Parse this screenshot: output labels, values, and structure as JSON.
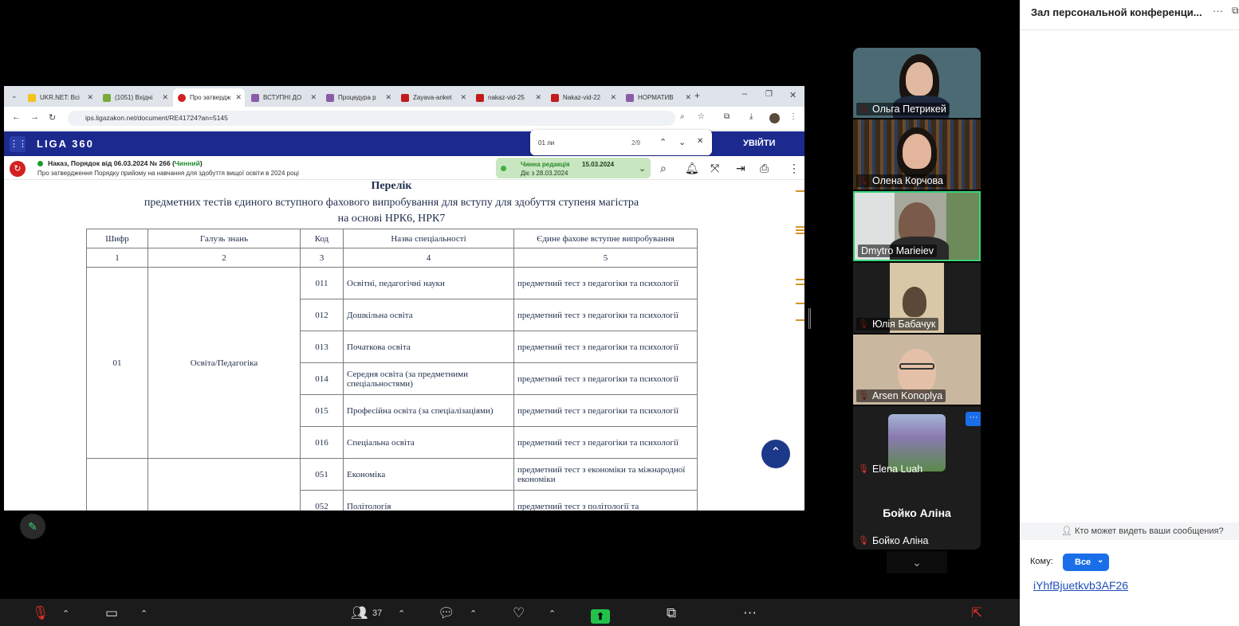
{
  "browser": {
    "tabs": [
      "UKR.NET: Всі",
      "(1051) Вхідні",
      "Про затвердж",
      "ВСТУПНІ ДО",
      "Процедура р",
      "Zayava-anket",
      "nakaz-vid-25",
      "Nakaz-vid-22",
      "НОРМАТИВ"
    ],
    "url": "ips.ligazakon.net/document/RE41724?an=5145",
    "find_query": "01 ли",
    "find_count": "2/9"
  },
  "liga": {
    "brand": "LIGA 360",
    "login": "УВІЙТИ"
  },
  "doc": {
    "title_prefix": "Наказ, Порядок від 06.03.2024 № 266 (",
    "status": "Чинний",
    "title_suffix": ")",
    "subtitle": "Про затвердження Порядку прийому на навчання для здобуття вищої освіти в 2024 році",
    "redaction_label": "Чинна редакція",
    "redaction_date": "15.03.2024",
    "valid_from": "Діє з 28.03.2024"
  },
  "content": {
    "title1": "Перелік",
    "title2": "предметних тестів єдиного вступного фахового випробування для вступу для здобуття ступеня магістра",
    "title3": "на основі НРК6, НРК7",
    "headers": [
      "Шифр",
      "Галузь знань",
      "Код",
      "Назва спеціальності",
      "Єдине фахове вступне випробування"
    ],
    "numbers": [
      "1",
      "2",
      "3",
      "4",
      "5"
    ],
    "group_code": "01",
    "group_name": "Освіта/Педагогіка",
    "rows": [
      {
        "code": "011",
        "name": "Освітні, педагогічні науки",
        "test": "предметний тест з педагогіки та психології"
      },
      {
        "code": "012",
        "name": "Дошкільна освіта",
        "test": "предметний тест з педагогіки та психології"
      },
      {
        "code": "013",
        "name": "Початкова освіта",
        "test": "предметний тест з педагогіки та психології"
      },
      {
        "code": "014",
        "name": "Середня освіта (за предметними спеціальностями)",
        "test": "предметний тест з педагогіки та психології"
      },
      {
        "code": "015",
        "name": "Професійна освіта (за спеціалізаціями)",
        "test": "предметний тест з педагогіки та психології"
      },
      {
        "code": "016",
        "name": "Спеціальна освіта",
        "test": "предметний тест з педагогіки та психології"
      },
      {
        "code": "051",
        "name": "Економіка",
        "test": "предметний тест з економіки та міжнародної економіки"
      },
      {
        "code": "052",
        "name": "Політологія",
        "test": "предметний тест з політології та"
      }
    ]
  },
  "participants": [
    {
      "name": "Ольга Петрикей"
    },
    {
      "name": "Олена Корчова"
    },
    {
      "name": "Dmytro Marieiev"
    },
    {
      "name": "Юлія Бабачук"
    },
    {
      "name": "Arsen Konoplya"
    },
    {
      "name": "Elena Luah"
    },
    {
      "name": "Бойко Аліна"
    }
  ],
  "chat": {
    "header": "Зал персональной конференци...",
    "privacy": "Кто может видеть ваши сообщения?",
    "to_label": "Кому:",
    "to_value": "Все",
    "message_link": "iYhfBjuetkvb3AF26"
  },
  "toolbar": {
    "participants_count": "37"
  }
}
